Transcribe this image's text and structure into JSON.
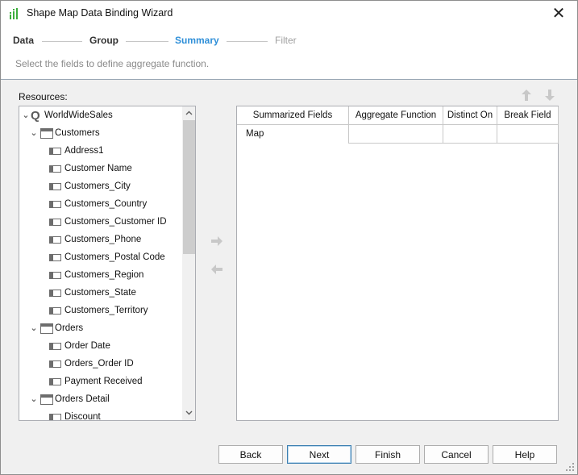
{
  "window": {
    "title": "Shape Map Data Binding Wizard",
    "app_icon": "bar-chart-icon",
    "close_glyph": "✕"
  },
  "steps": [
    {
      "label": "Data",
      "state": "done"
    },
    {
      "label": "Group",
      "state": "done"
    },
    {
      "label": "Summary",
      "state": "active"
    },
    {
      "label": "Filter",
      "state": "future"
    }
  ],
  "subtitle": "Select the fields to define aggregate function.",
  "resources": {
    "label": "Resources:",
    "tree": [
      {
        "label": "WorldWideSales",
        "kind": "query",
        "expanded": true
      },
      {
        "label": "Customers",
        "kind": "table",
        "expanded": true
      },
      {
        "label": "Address1",
        "kind": "field"
      },
      {
        "label": "Customer Name",
        "kind": "field"
      },
      {
        "label": "Customers_City",
        "kind": "field"
      },
      {
        "label": "Customers_Country",
        "kind": "field"
      },
      {
        "label": "Customers_Customer ID",
        "kind": "field"
      },
      {
        "label": "Customers_Phone",
        "kind": "field"
      },
      {
        "label": "Customers_Postal Code",
        "kind": "field"
      },
      {
        "label": "Customers_Region",
        "kind": "field"
      },
      {
        "label": "Customers_State",
        "kind": "field"
      },
      {
        "label": "Customers_Territory",
        "kind": "field"
      },
      {
        "label": "Orders",
        "kind": "table",
        "expanded": true
      },
      {
        "label": "Order Date",
        "kind": "field"
      },
      {
        "label": "Orders_Order ID",
        "kind": "field"
      },
      {
        "label": "Payment Received",
        "kind": "field"
      },
      {
        "label": "Orders Detail",
        "kind": "table",
        "expanded": true
      },
      {
        "label": "Discount",
        "kind": "field"
      }
    ]
  },
  "icons": {
    "move_up": "arrow-up-icon",
    "move_down": "arrow-down-icon",
    "add": "arrow-right-icon",
    "remove": "arrow-left-icon"
  },
  "grid": {
    "columns": [
      "Summarized Fields",
      "Aggregate Function",
      "Distinct On",
      "Break Field"
    ],
    "rows": [
      [
        "Map",
        "",
        "",
        ""
      ]
    ]
  },
  "buttons": {
    "back": "Back",
    "next": "Next",
    "finish": "Finish",
    "cancel": "Cancel",
    "help": "Help"
  },
  "colors": {
    "active_step": "#2f8fd8",
    "done_step": "#333333",
    "future_step": "#a0a0a0",
    "subtitle": "#8a8a8a"
  }
}
